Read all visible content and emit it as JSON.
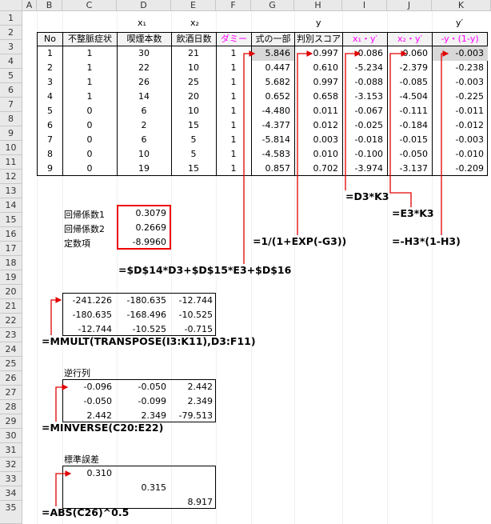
{
  "columns": [
    "A",
    "B",
    "C",
    "D",
    "E",
    "F",
    "G",
    "H",
    "I",
    "J",
    "K"
  ],
  "rows": [
    "1",
    "2",
    "3",
    "4",
    "5",
    "6",
    "7",
    "8",
    "9",
    "10",
    "11",
    "12",
    "13",
    "14",
    "15",
    "16",
    "17",
    "18",
    "19",
    "20",
    "21",
    "22",
    "23",
    "24",
    "25",
    "26",
    "27",
    "28",
    "29",
    "30",
    "31",
    "32",
    "33",
    "34",
    "35"
  ],
  "axis_labels": {
    "D": "x₁",
    "E": "x₂",
    "H": "y",
    "K": "y′"
  },
  "table": {
    "headers": [
      "No",
      "不整脈症状",
      "喫煙本数",
      "飲酒日数",
      "ダミー",
      "式の一部",
      "判別スコア",
      "x₁・y′",
      "x₂・y′",
      "-y・(1-y)"
    ],
    "rows": [
      [
        "1",
        "1",
        "30",
        "21",
        "1",
        "5.846",
        "0.997",
        "0.086",
        "-0.060",
        "-0.003"
      ],
      [
        "2",
        "1",
        "22",
        "10",
        "1",
        "0.447",
        "0.610",
        "-5.234",
        "-2.379",
        "-0.238"
      ],
      [
        "3",
        "1",
        "26",
        "25",
        "1",
        "5.682",
        "0.997",
        "-0.088",
        "-0.085",
        "-0.003"
      ],
      [
        "4",
        "1",
        "14",
        "20",
        "1",
        "0.652",
        "0.658",
        "-3.153",
        "-4.504",
        "-0.225"
      ],
      [
        "5",
        "0",
        "6",
        "10",
        "1",
        "-4.480",
        "0.011",
        "-0.067",
        "-0.111",
        "-0.011"
      ],
      [
        "6",
        "0",
        "2",
        "15",
        "1",
        "-4.377",
        "0.012",
        "-0.025",
        "-0.184",
        "-0.012"
      ],
      [
        "7",
        "0",
        "6",
        "5",
        "1",
        "-5.814",
        "0.003",
        "-0.018",
        "-0.015",
        "-0.003"
      ],
      [
        "8",
        "0",
        "10",
        "5",
        "1",
        "-4.583",
        "0.010",
        "-0.100",
        "-0.050",
        "-0.010"
      ],
      [
        "9",
        "0",
        "19",
        "15",
        "1",
        "0.857",
        "0.702",
        "-3.974",
        "-3.137",
        "-0.209"
      ]
    ]
  },
  "formulas": {
    "k3": "=D3*K3",
    "e3": "=E3*K3",
    "exp": "=1/(1+EXP(-G3))",
    "h3": "=-H3*(1-H3)",
    "g": "=$D$14*D3+$D$15*E3+$D$16",
    "mmult": "=MMULT(TRANSPOSE(I3:K11),D3:F11)",
    "minverse": "=MINVERSE(C20:E22)",
    "abs": "=ABS(C26)^0.5"
  },
  "coef": {
    "labels": [
      "回帰係数1",
      "回帰係数2",
      "定数項"
    ],
    "values": [
      "0.3079",
      "0.2669",
      "-8.9960"
    ]
  },
  "mmult_matrix": [
    [
      "-241.226",
      "-180.635",
      "-12.744"
    ],
    [
      "-180.635",
      "-168.496",
      "-10.525"
    ],
    [
      "-12.744",
      "-10.525",
      "-0.715"
    ]
  ],
  "inverse": {
    "title": "逆行列",
    "matrix": [
      [
        "-0.096",
        "-0.050",
        "2.442"
      ],
      [
        "-0.050",
        "-0.099",
        "2.349"
      ],
      [
        "2.442",
        "2.349",
        "-79.513"
      ]
    ]
  },
  "stderr": {
    "title": "標準誤差",
    "values": [
      "0.310",
      "0.315",
      "8.917"
    ]
  },
  "colors": {
    "accent": "#e00000",
    "header_magenta": "#ff00ff",
    "selected_fill": "#d8d8d8"
  }
}
